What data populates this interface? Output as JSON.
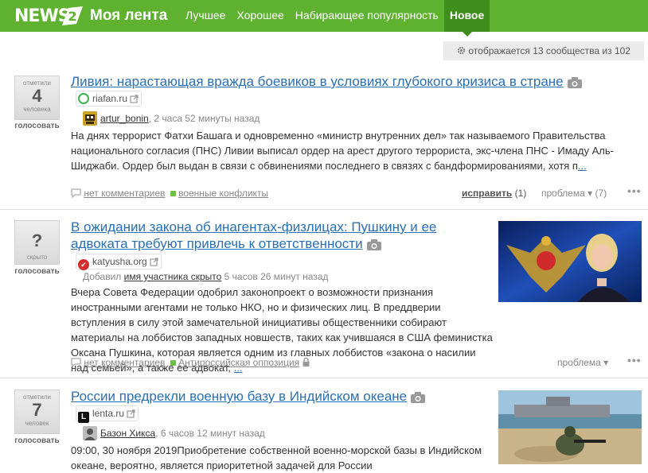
{
  "header": {
    "logo_text": "NEWS",
    "logo_badge": "2",
    "title": "Моя лента",
    "nav": [
      "Лучшее",
      "Хорошее",
      "Набирающее популярность",
      "Новое"
    ],
    "active_nav": "Новое"
  },
  "communities_note": "отображается 13 сообщества из 102",
  "items": [
    {
      "vote_top": "отметили",
      "vote_count": "4",
      "vote_bottom": "человека",
      "vote_action": "голосовать",
      "title": "Ливия: нарастающая вражда боевиков в условиях глубокого кризиса в стране",
      "source": "riafan.ru",
      "author": "artur_bonin",
      "time": "2 часа 52 минуты назад",
      "text": "На днях террорист Фатхи Башага и одновременно «министр внутренних дел» так называемого Правительства национального согласия (ПНС) Ливии выписал ордер на арест другого террориста, экс-члена ПНС - Имаду Аль-Шиджаби. Ордер был выдан в связи с обвинениями последнего в связях с бандформированиями, хотя п",
      "more": "...",
      "comments": "нет комментариев",
      "tag": "военные конфликты",
      "fix": "исправить",
      "fix_count": "(1)",
      "problem": "проблема",
      "problem_count": "(7)"
    },
    {
      "vote_top": "скрыто",
      "vote_count": "?",
      "vote_action": "голосовать",
      "title": "В ожидании закона об инагентах-физлицах: Пушкину и ее адвоката требуют привлечь к ответственности",
      "source": "katyusha.org",
      "added_label": "Добавил",
      "author": "имя участника скрыто",
      "time": "5 часов 26 минут назад",
      "text": "Вчера Совета Федерации одобрил законопроект о возможности признания иностранными агентами не только НКО, но и физических лиц. В преддверии вступления в силу этой замечательной инициативы общественники собирают материалы на лоббистов западных новшеств, таких как учившаяся в США феминистка Оксана Пушкина, которая является одним из главных лоббистов «закона о насилии над семьей», а также ее адвокат,",
      "more": "...",
      "comments": "нет комментариев",
      "tag": "Антироссийская оппозиция",
      "problem": "проблема"
    },
    {
      "vote_top": "отметили",
      "vote_count": "7",
      "vote_bottom": "человек",
      "vote_action": "голосовать",
      "title": "России предрекли военную базу в Индийском океане",
      "source": "lenta.ru",
      "author": "Базон Хикса",
      "time": "6 часов 12 минут назад",
      "text": "09:00, 30 ноября 2019Приобретение собственной военно-морской базы в Индийском океане, вероятно, является приоритетной задачей для России"
    }
  ]
}
